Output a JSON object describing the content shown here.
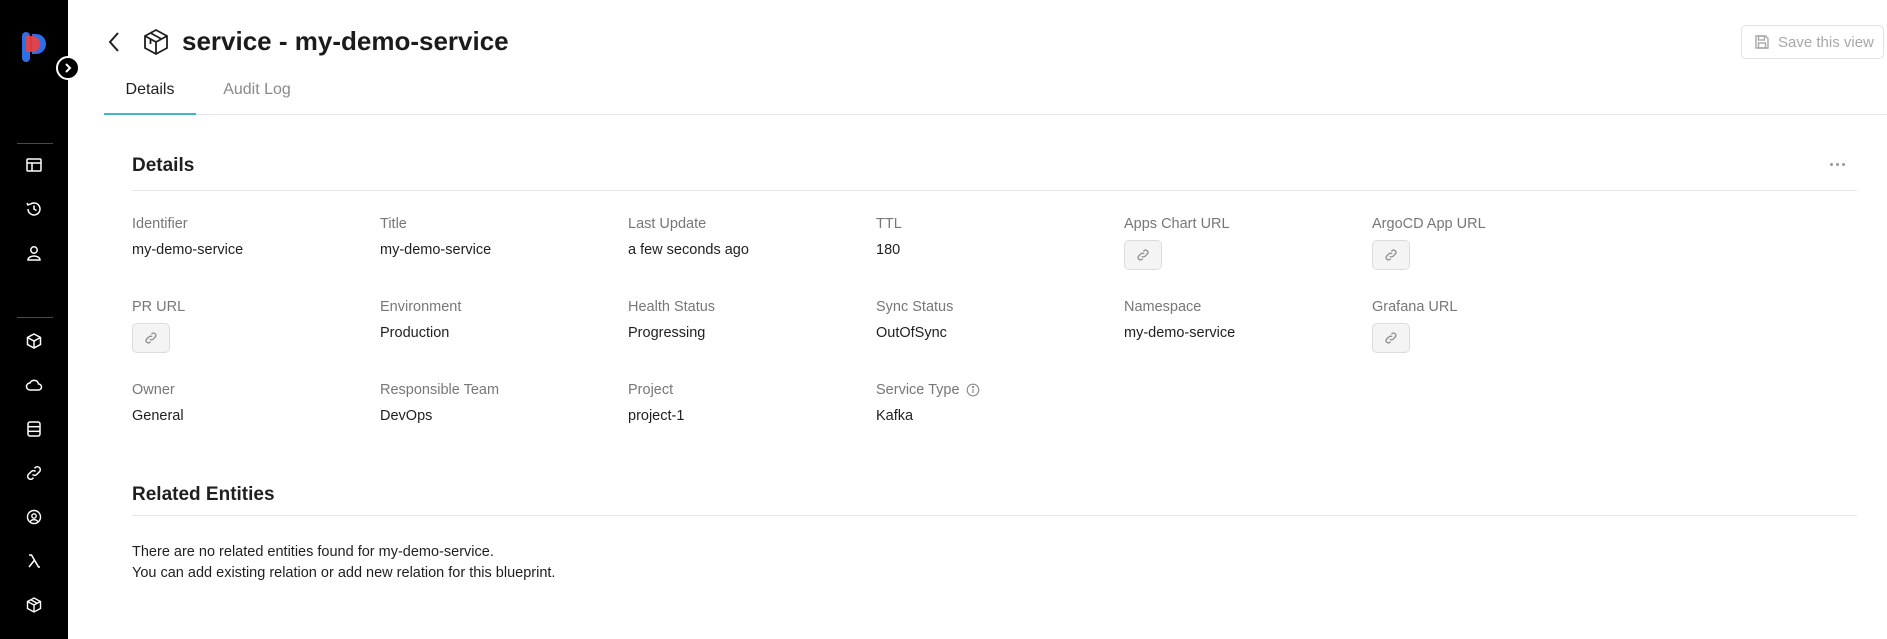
{
  "page": {
    "title": "service - my-demo-service",
    "save_label": "Save this view"
  },
  "tabs": [
    {
      "label": "Details",
      "active": true
    },
    {
      "label": "Audit Log",
      "active": false
    }
  ],
  "details": {
    "section_title": "Details",
    "fields": [
      {
        "label": "Identifier",
        "value": "my-demo-service",
        "type": "text"
      },
      {
        "label": "Title",
        "value": "my-demo-service",
        "type": "text"
      },
      {
        "label": "Last Update",
        "value": "a few seconds ago",
        "type": "text"
      },
      {
        "label": "TTL",
        "value": "180",
        "type": "text"
      },
      {
        "label": "Apps Chart URL",
        "value": "",
        "type": "link"
      },
      {
        "label": "ArgoCD App URL",
        "value": "",
        "type": "link"
      },
      {
        "label": "PR URL",
        "value": "",
        "type": "link"
      },
      {
        "label": "Environment",
        "value": "Production",
        "type": "text"
      },
      {
        "label": "Health Status",
        "value": "Progressing",
        "type": "text"
      },
      {
        "label": "Sync Status",
        "value": "OutOfSync",
        "type": "text"
      },
      {
        "label": "Namespace",
        "value": "my-demo-service",
        "type": "text"
      },
      {
        "label": "Grafana URL",
        "value": "",
        "type": "link"
      },
      {
        "label": "Owner",
        "value": "General",
        "type": "text"
      },
      {
        "label": "Responsible Team",
        "value": "DevOps",
        "type": "text"
      },
      {
        "label": "Project",
        "value": "project-1",
        "type": "text"
      },
      {
        "label": "Service Type",
        "value": "Kafka",
        "type": "text",
        "info": true
      }
    ]
  },
  "related": {
    "section_title": "Related Entities",
    "empty_line_1": "There are no related entities found for my-demo-service.",
    "empty_line_2": "You can add existing relation or add new relation for this blueprint."
  },
  "sidebar": {
    "icons": [
      "catalog-icon",
      "history-icon",
      "user-icon",
      "cube-icon",
      "cloud-icon",
      "database-icon",
      "link-icon",
      "team-icon",
      "lambda-icon",
      "blueprint-icon"
    ]
  },
  "colors": {
    "sidebar_bg": "#000000",
    "tab_accent": "#3fb6c8",
    "logo_blue": "#2f6fe6",
    "logo_red": "#ef3f3f"
  }
}
